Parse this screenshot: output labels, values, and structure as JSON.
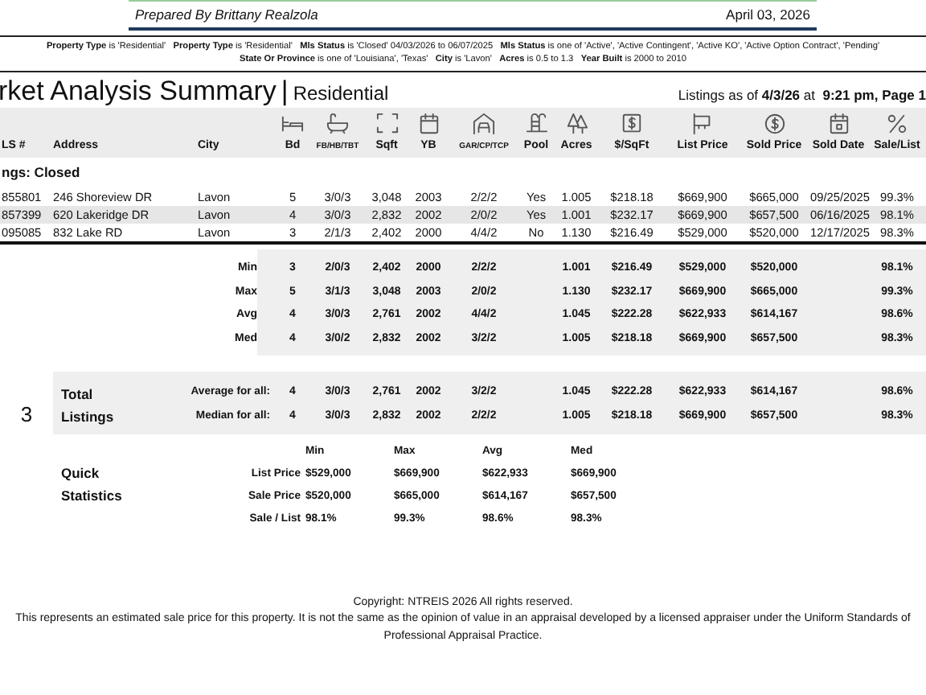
{
  "header": {
    "prepared_by": "Prepared By Brittany Realzola",
    "date": "April 03, 2026"
  },
  "criteria": "**Property Type** is 'Residential'   **Property Type** is 'Residential'   **Mls Status** is 'Closed' 04/03/2026 to 06/07/2025   **Mls Status** is one of 'Active', 'Active Contingent', 'Active KO', 'Active Option Contract', 'Pending'   **State Or Province** is one of 'Louisiana', 'Texas'   **City** is 'Lavon'   **Acres** is 0.5 to 1.3   **Year Built** is 2000 to 2010",
  "title": "rket Analysis Summary",
  "separator": "|",
  "subtitle": "Residential",
  "listings_as_of": "Listings as of **4/3/26** at  **9:21 pm, Page 1**",
  "columns": [
    "LS #",
    "Address",
    "City",
    "Bd",
    "FB/HB/TBT",
    "Sqft",
    "YB",
    "GAR/CP/TCP",
    "Pool",
    "Acres",
    "$/SqFt",
    "List Price",
    "Sold Price",
    "Sold Date",
    "Sale/List"
  ],
  "status_group": "ngs: Closed",
  "rows": [
    {
      "cells": [
        "855801",
        "246 Shoreview DR",
        "Lavon",
        "5",
        "3/0/3",
        "3,048",
        "2003",
        "2/2/2",
        "Yes",
        "1.005",
        "$218.18",
        "$669,900",
        "$665,000",
        "09/25/2025",
        "99.3%"
      ]
    },
    {
      "cells": [
        "857399",
        "620 Lakeridge DR",
        "Lavon",
        "4",
        "3/0/3",
        "2,832",
        "2002",
        "2/0/2",
        "Yes",
        "1.001",
        "$232.17",
        "$669,900",
        "$657,500",
        "06/16/2025",
        "98.1%"
      ]
    },
    {
      "cells": [
        "095085",
        "832 Lake RD",
        "Lavon",
        "3",
        "2/1/3",
        "2,402",
        "2000",
        "4/4/2",
        "No",
        "1.130",
        "$216.49",
        "$529,000",
        "$520,000",
        "12/17/2025",
        "98.3%"
      ]
    }
  ],
  "stats": [
    {
      "label": "Min",
      "cells": [
        "3",
        "2/0/3",
        "2,402",
        "2000",
        "2/2/2",
        "1.001",
        "$216.49",
        "$529,000",
        "$520,000",
        "98.1%"
      ]
    },
    {
      "label": "Max",
      "cells": [
        "5",
        "3/1/3",
        "3,048",
        "2003",
        "2/0/2",
        "1.130",
        "$232.17",
        "$669,900",
        "$665,000",
        "99.3%"
      ]
    },
    {
      "label": "Avg",
      "cells": [
        "4",
        "3/0/3",
        "2,761",
        "2002",
        "4/4/2",
        "1.045",
        "$222.28",
        "$622,933",
        "$614,167",
        "98.6%"
      ]
    },
    {
      "label": "Med",
      "cells": [
        "4",
        "3/0/2",
        "2,832",
        "2002",
        "3/2/2",
        "1.005",
        "$218.18",
        "$669,900",
        "$657,500",
        "98.3%"
      ]
    }
  ],
  "totals": {
    "count": "3",
    "label": "Total Listings",
    "rows": [
      {
        "label": "Average for all:",
        "cells": [
          "4",
          "3/0/3",
          "2,761",
          "2002",
          "3/2/2",
          "1.045",
          "$222.28",
          "$622,933",
          "$614,167",
          "98.6%"
        ]
      },
      {
        "label": "Median for all:",
        "cells": [
          "4",
          "3/0/3",
          "2,832",
          "2002",
          "2/2/2",
          "1.005",
          "$218.18",
          "$669,900",
          "$657,500",
          "98.3%"
        ]
      }
    ]
  },
  "quick_stats": {
    "title": "Quick Statistics",
    "columns": [
      "Min",
      "Max",
      "Avg",
      "Med"
    ],
    "rows": [
      {
        "label": "List Price",
        "values": [
          "$529,000",
          "$669,900",
          "$622,933",
          "$669,900"
        ]
      },
      {
        "label": "Sale Price",
        "values": [
          "$520,000",
          "$665,000",
          "$614,167",
          "$657,500"
        ]
      },
      {
        "label": "Sale / List",
        "values": [
          "98.1%",
          "99.3%",
          "98.6%",
          "98.3%"
        ]
      }
    ]
  },
  "footer": {
    "copyright": "Copyright: NTREIS 2026 All rights reserved.",
    "disclaimer": "This represents an estimated sale price for this property. It is not the same as the opinion of value in an appraisal developed by a licensed appraiser under the Uniform Standards of Professional Appraisal Practice."
  }
}
